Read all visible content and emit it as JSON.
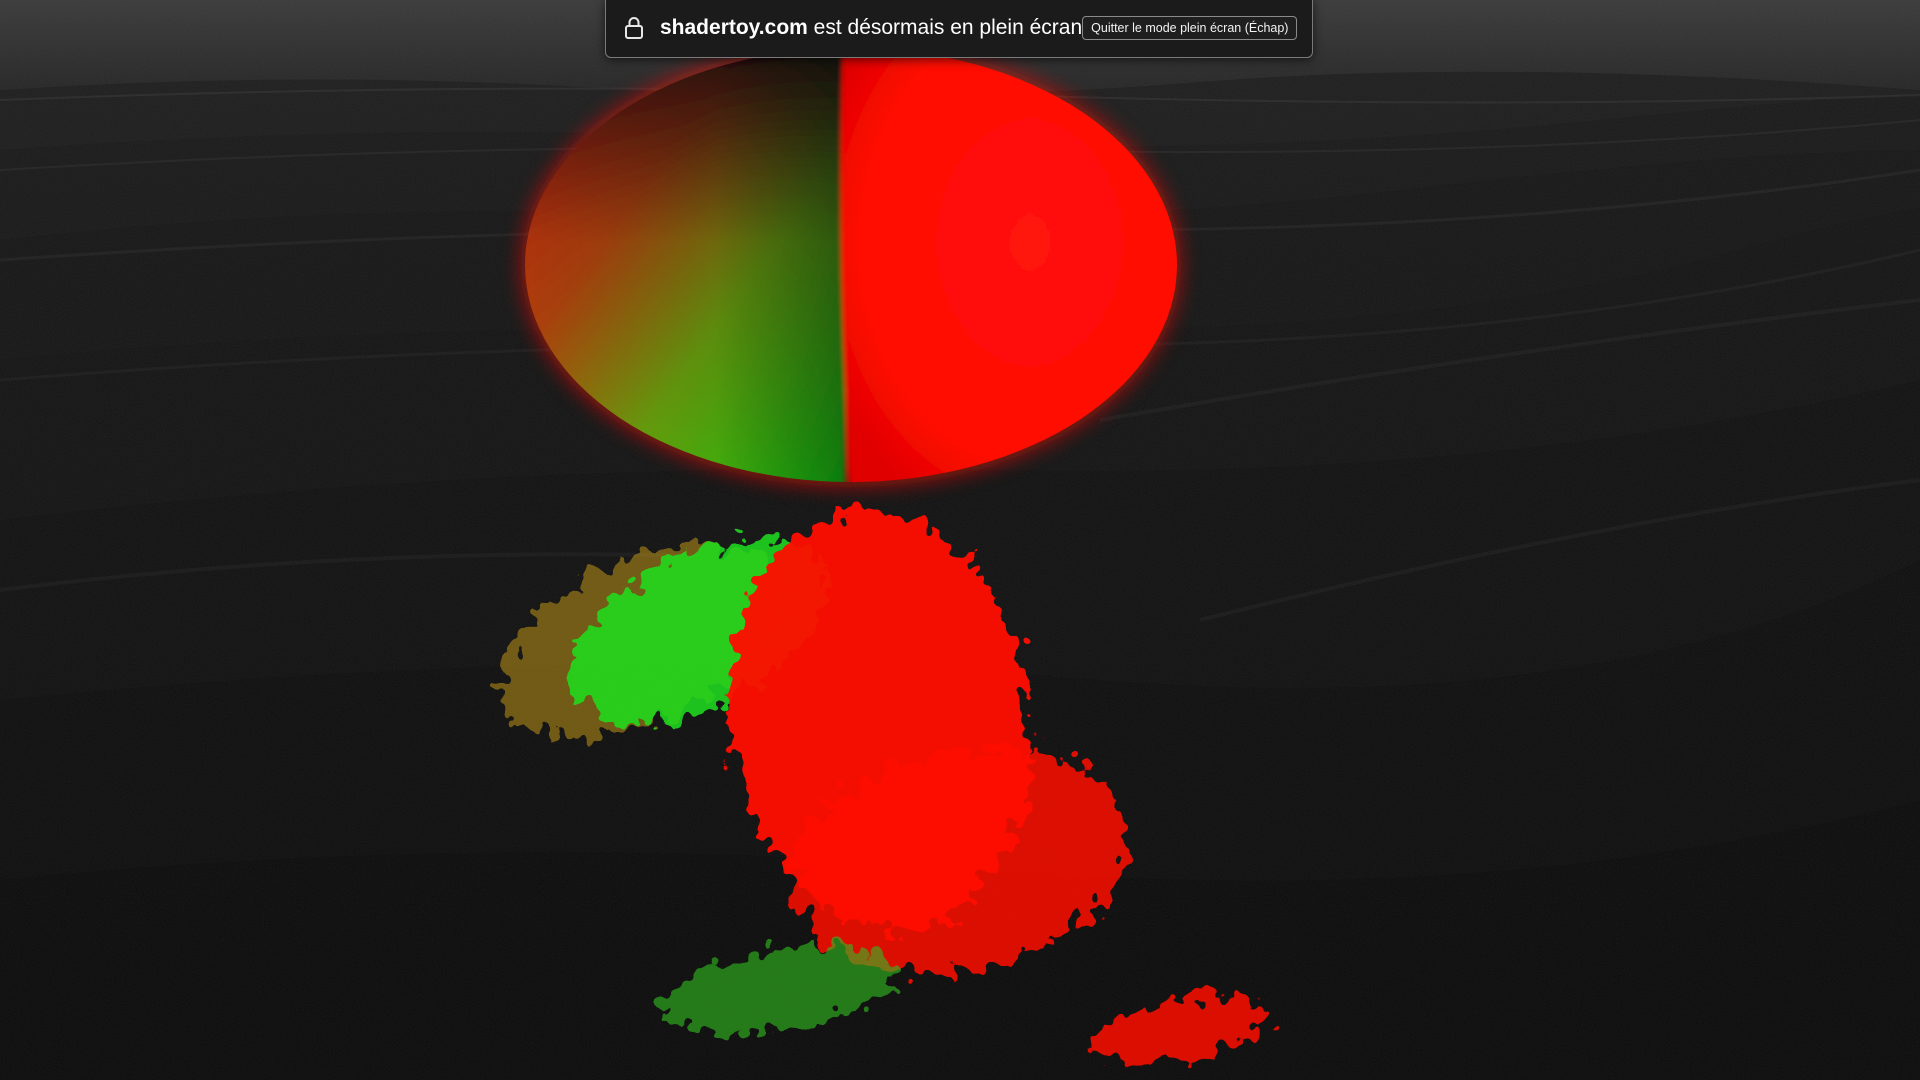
{
  "banner": {
    "domain": "shadertoy.com",
    "message": " est désormais en plein écran",
    "exit_button_label": "Quitter le mode plein écran (Échap)",
    "icon": "lock-icon"
  },
  "scene": {
    "description_icon": "shader-render",
    "colors": {
      "background": "#0b0b0b",
      "sphere_red": "#ff1a0a",
      "sphere_green": "#22b510",
      "terrain": "#2a2a2a"
    }
  }
}
